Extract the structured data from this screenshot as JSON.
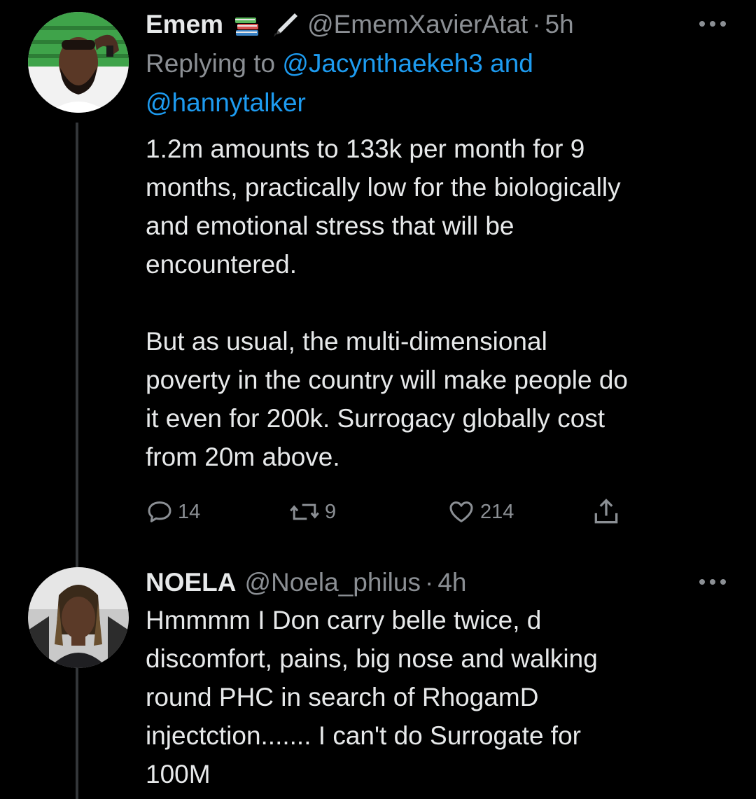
{
  "tweets": [
    {
      "name": "Emem",
      "emojis": [
        "books-icon",
        "fountain-pen-icon"
      ],
      "handle": "@EmemXavierAtat",
      "separator": "·",
      "time": "5h",
      "replying_prefix": "Replying to ",
      "replying_user1": "@Jacynthaekeh3",
      "replying_and": " and",
      "replying_user2": "@hannytalker",
      "body": "1.2m amounts to 133k per month for 9\nmonths, practically low for the biologically\nand emotional stress that will be\nencountered.\n\nBut as usual, the multi-dimensional\npoverty in the country will make people do\nit even for 200k. Surrogacy globally cost\nfrom 20m above.",
      "actions": {
        "replies": "14",
        "retweets": "9",
        "likes": "214"
      }
    },
    {
      "name": "NOELA",
      "handle": "@Noela_philus",
      "separator": "·",
      "time": "4h",
      "body": "Hmmmm I Don carry belle twice, d\ndiscomfort, pains, big nose and walking\nround PHC in search of RhogamD\ninjectction....... I can't do Surrogate for\n100M"
    }
  ],
  "colors": {
    "background": "#000000",
    "text": "#e7e9ea",
    "secondary": "#8b8f94",
    "link": "#1d9bf0",
    "thread_line": "#333639"
  }
}
